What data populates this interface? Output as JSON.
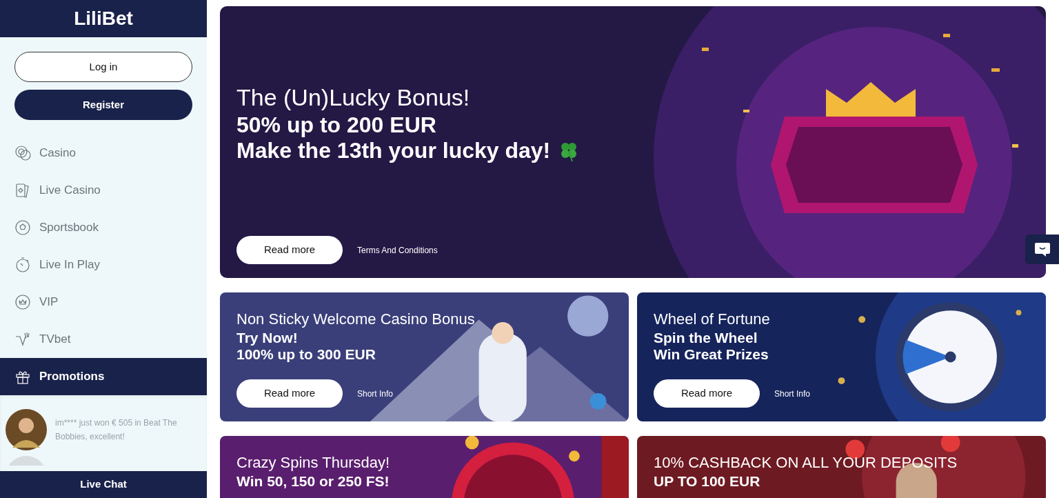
{
  "logo": "LiliBet",
  "auth": {
    "login": "Log in",
    "register": "Register"
  },
  "nav": [
    {
      "label": "Casino",
      "kind": "chips",
      "selected": false
    },
    {
      "label": "Live Casino",
      "kind": "cards",
      "selected": false
    },
    {
      "label": "Sportsbook",
      "kind": "ball",
      "selected": false
    },
    {
      "label": "Live In Play",
      "kind": "stopwatch",
      "selected": false
    },
    {
      "label": "VIP",
      "kind": "crown",
      "selected": false
    },
    {
      "label": "TVbet",
      "kind": "tv",
      "selected": false
    },
    {
      "label": "Promotions",
      "kind": "gift",
      "selected": true
    }
  ],
  "winner": {
    "text": "im**** just won € 505 in Beat The Bobbies, excellent!"
  },
  "live_chat": "Live Chat",
  "hero": {
    "title": "The (Un)Lucky Bonus!",
    "lines": [
      "50% up to 200 EUR",
      "Make the 13th your lucky day!"
    ],
    "button": "Read more",
    "link": "Terms And Conditions"
  },
  "promos": [
    {
      "kind": "mountain",
      "title": "Non Sticky Welcome Casino Bonus",
      "lines": [
        "Try Now!",
        "100% up to 300 EUR"
      ],
      "button": "Read more",
      "link": "Short Info"
    },
    {
      "kind": "wheel",
      "title": "Wheel of Fortune",
      "lines": [
        "Spin the Wheel",
        "Win Great Prizes"
      ],
      "button": "Read more",
      "link": "Short Info"
    },
    {
      "kind": "spins",
      "title": "Crazy Spins Thursday!",
      "lines": [
        "Win 50, 150 or 250 FS!"
      ]
    },
    {
      "kind": "cashback",
      "title": "10% CASHBACK ON ALL YOUR DEPOSITS",
      "lines": [
        "UP TO 100 EUR"
      ]
    }
  ]
}
